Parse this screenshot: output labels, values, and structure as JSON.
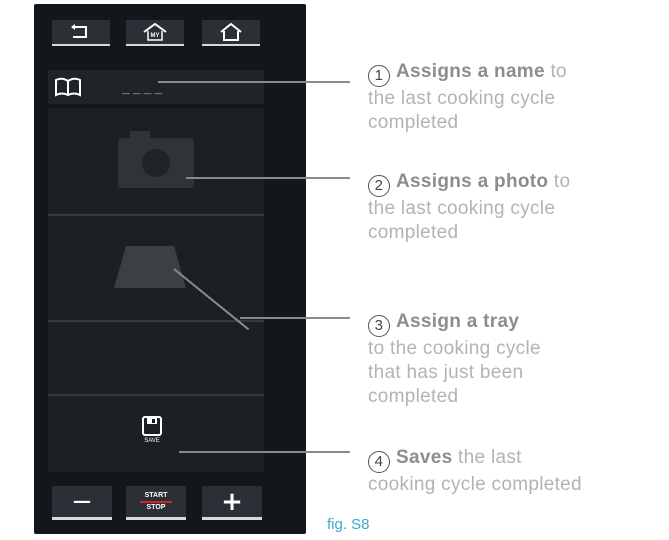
{
  "device": {
    "nav": {
      "back_icon": "back-arrow-icon",
      "my_home_icon": "my-home-icon",
      "my_home_label": "MY",
      "home_icon": "home-icon"
    },
    "name_row": {
      "icon": "recipe-book-icon",
      "placeholder": "____"
    },
    "photo_icon": "camera-icon",
    "tray_icon": "tray-icon",
    "save": {
      "icon": "floppy-disk-icon",
      "label": "SAVE"
    },
    "bottom": {
      "minus_label": "−",
      "start_label": "START",
      "stop_label": "STOP",
      "plus_label": "+"
    }
  },
  "callouts": [
    {
      "number": "1",
      "bold": "Assigns a name",
      "rest": "to",
      "lines": [
        "the last cooking cycle",
        "completed"
      ]
    },
    {
      "number": "2",
      "bold": "Assigns a photo",
      "rest": "to",
      "lines": [
        "the last cooking cycle",
        "completed"
      ]
    },
    {
      "number": "3",
      "bold": "Assign a tray",
      "rest": "",
      "lines": [
        "to the cooking cycle",
        "that has just been",
        "completed"
      ]
    },
    {
      "number": "4",
      "bold": "Saves",
      "rest": "the last",
      "lines": [
        "cooking cycle completed"
      ]
    }
  ],
  "figure_label": "fig. S8",
  "colors": {
    "panel": "#13171b",
    "button": "#2a3036",
    "accent_red": "#d8202a",
    "fig_label": "#3aa8c9",
    "callout_text": "#b3b3b3"
  }
}
